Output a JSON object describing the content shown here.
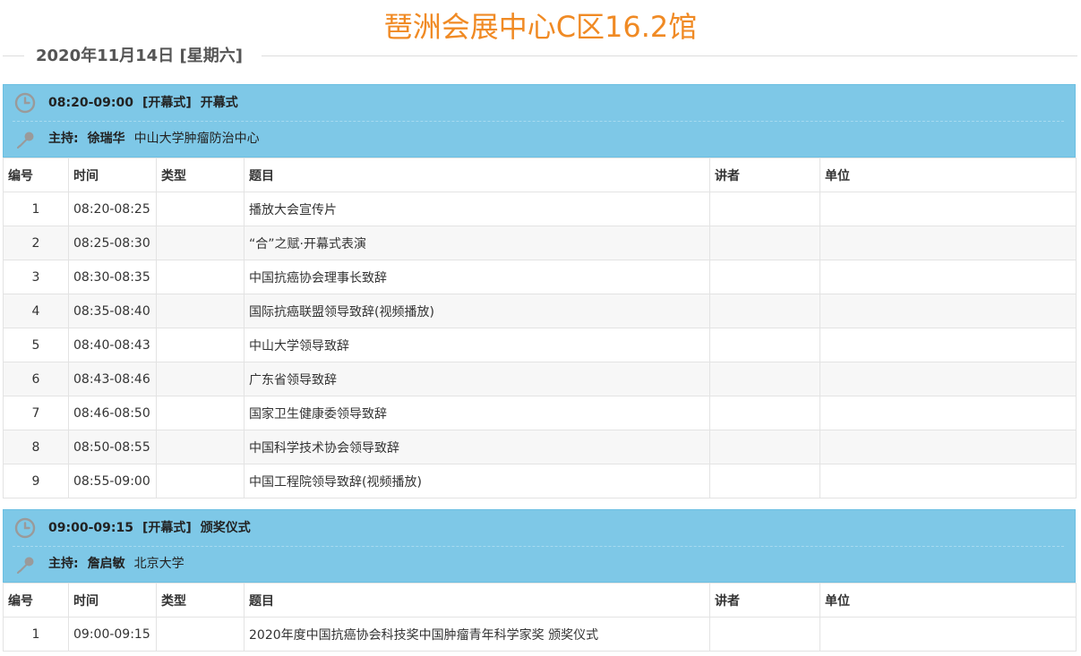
{
  "venue_title": "琶洲会展中心C区16.2馆",
  "date_label": "2020年11月14日 [星期六]",
  "colors": {
    "accent": "#f08a24",
    "session_header": "#7ec8e7"
  },
  "table_headers": [
    "编号",
    "时间",
    "类型",
    "题目",
    "讲者",
    "单位"
  ],
  "sessions": [
    {
      "time": "08:20-09:00",
      "tag": "[开幕式]",
      "name": "开幕式",
      "host_label": "主持:",
      "host_name": "徐瑞华",
      "host_org": "中山大学肿瘤防治中心",
      "rows": [
        {
          "no": "1",
          "time": "08:20-08:25",
          "type": "",
          "topic": "播放大会宣传片",
          "speaker": "",
          "org": ""
        },
        {
          "no": "2",
          "time": "08:25-08:30",
          "type": "",
          "topic": "“合”之赋·开幕式表演",
          "speaker": "",
          "org": ""
        },
        {
          "no": "3",
          "time": "08:30-08:35",
          "type": "",
          "topic": "中国抗癌协会理事长致辞",
          "speaker": "",
          "org": ""
        },
        {
          "no": "4",
          "time": "08:35-08:40",
          "type": "",
          "topic": "国际抗癌联盟领导致辞(视频播放)",
          "speaker": "",
          "org": ""
        },
        {
          "no": "5",
          "time": "08:40-08:43",
          "type": "",
          "topic": "中山大学领导致辞",
          "speaker": "",
          "org": ""
        },
        {
          "no": "6",
          "time": "08:43-08:46",
          "type": "",
          "topic": "广东省领导致辞",
          "speaker": "",
          "org": ""
        },
        {
          "no": "7",
          "time": "08:46-08:50",
          "type": "",
          "topic": "国家卫生健康委领导致辞",
          "speaker": "",
          "org": ""
        },
        {
          "no": "8",
          "time": "08:50-08:55",
          "type": "",
          "topic": "中国科学技术协会领导致辞",
          "speaker": "",
          "org": ""
        },
        {
          "no": "9",
          "time": "08:55-09:00",
          "type": "",
          "topic": "中国工程院领导致辞(视频播放)",
          "speaker": "",
          "org": ""
        }
      ]
    },
    {
      "time": "09:00-09:15",
      "tag": "[开幕式]",
      "name": "颁奖仪式",
      "host_label": "主持:",
      "host_name": "詹启敏",
      "host_org": "北京大学",
      "rows": [
        {
          "no": "1",
          "time": "09:00-09:15",
          "type": "",
          "topic": "2020年度中国抗癌协会科技奖中国肿瘤青年科学家奖 颁奖仪式",
          "speaker": "",
          "org": ""
        }
      ]
    }
  ]
}
